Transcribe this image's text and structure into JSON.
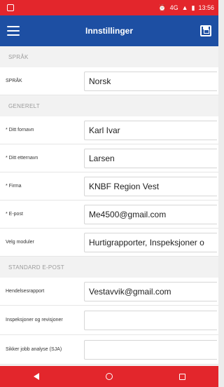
{
  "status_bar": {
    "time": "13:56",
    "signal": "4G"
  },
  "app_bar": {
    "title": "Innstillinger"
  },
  "sections": {
    "language": {
      "header": "SPRÅK",
      "label": "SPRÅK",
      "value": "Norsk"
    },
    "general": {
      "header": "GENERELT",
      "first_name": {
        "label": "* Ditt fornavn",
        "value": "Karl Ivar"
      },
      "last_name": {
        "label": "* Ditt etternavn",
        "value": "Larsen"
      },
      "company": {
        "label": "* Firma",
        "value": "KNBF Region Vest"
      },
      "email": {
        "label": "* E-post",
        "value": "Me4500@gmail.com"
      },
      "modules": {
        "label": "Velg moduler",
        "value": "Hurtigrapporter, Inspeksjoner o"
      }
    },
    "standard_email": {
      "header": "STANDARD E-POST",
      "incident": {
        "label": "Hendelsesrapport",
        "value": "Vestavvik@gmail.com"
      },
      "inspections": {
        "label": "Inspeksjoner og revisjoner",
        "value": ""
      },
      "sja": {
        "label": "Sikker jobb analyse (SJA)",
        "value": ""
      }
    }
  }
}
